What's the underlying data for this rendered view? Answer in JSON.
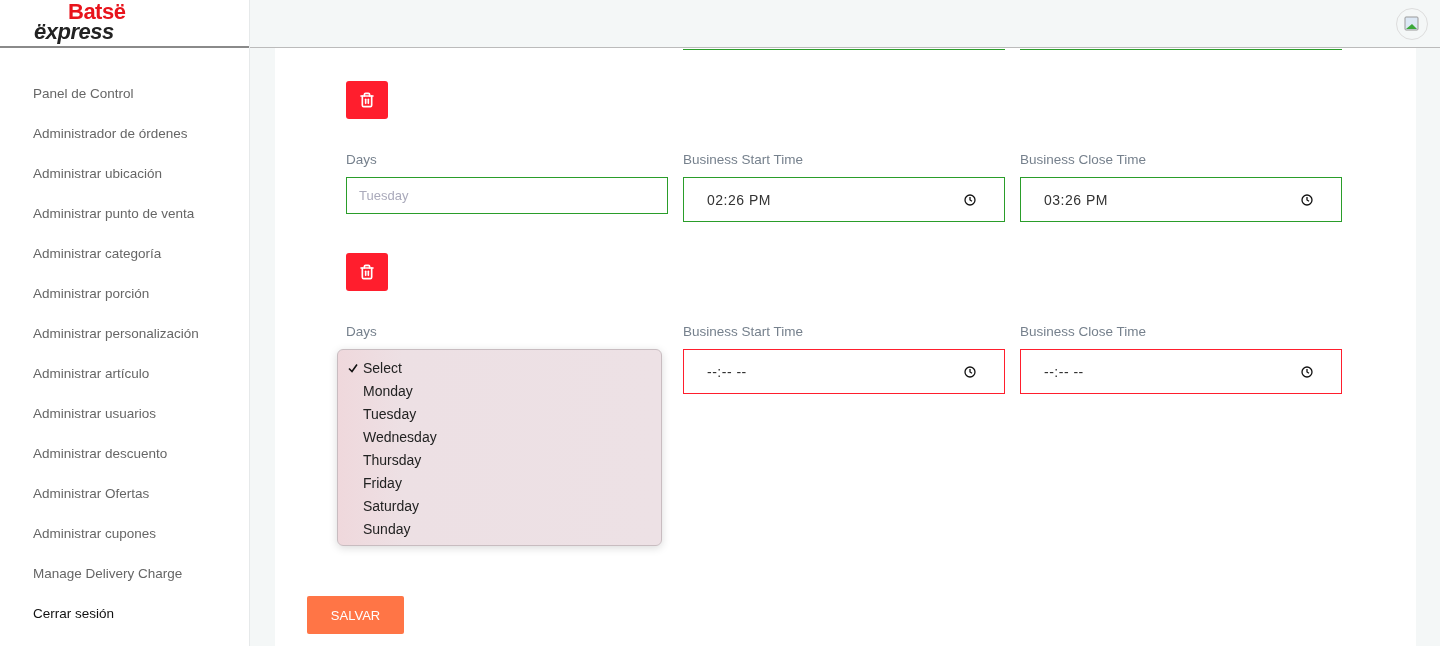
{
  "logo": {
    "top": "Batsë",
    "bottom": "ëxpress"
  },
  "sidebar": {
    "items": [
      {
        "label": "Panel de Control",
        "kind": "nav"
      },
      {
        "label": "Administrador de órdenes",
        "kind": "nav"
      },
      {
        "label": "Administrar ubicación",
        "kind": "nav"
      },
      {
        "label": "Administrar punto de venta",
        "kind": "nav"
      },
      {
        "label": "Administrar categoría",
        "kind": "nav"
      },
      {
        "label": "Administrar porción",
        "kind": "nav"
      },
      {
        "label": "Administrar personalización",
        "kind": "nav"
      },
      {
        "label": "Administrar artículo",
        "kind": "nav"
      },
      {
        "label": "Administrar usuarios",
        "kind": "nav"
      },
      {
        "label": "Administrar descuento",
        "kind": "nav"
      },
      {
        "label": "Administrar Ofertas",
        "kind": "nav"
      },
      {
        "label": "Administrar cupones",
        "kind": "nav"
      },
      {
        "label": "Manage Delivery Charge",
        "kind": "nav"
      },
      {
        "label": "Cerrar sesión",
        "kind": "logout"
      }
    ]
  },
  "schedule_rows": [
    {
      "days": {
        "label": "Days",
        "kind": "text",
        "placeholder": "Tuesday",
        "invalid": false
      },
      "start": {
        "label": "Business Start Time",
        "value": "02:26 PM",
        "invalid": false
      },
      "close": {
        "label": "Business Close Time",
        "value": "03:26 PM",
        "invalid": false
      }
    },
    {
      "days": {
        "label": "Days",
        "kind": "dropdown",
        "invalid": true,
        "options": [
          {
            "label": "Select",
            "selected": true
          },
          {
            "label": "Monday",
            "selected": false
          },
          {
            "label": "Tuesday",
            "selected": false
          },
          {
            "label": "Wednesday",
            "selected": false
          },
          {
            "label": "Thursday",
            "selected": false
          },
          {
            "label": "Friday",
            "selected": false
          },
          {
            "label": "Saturday",
            "selected": false
          },
          {
            "label": "Sunday",
            "selected": false
          }
        ]
      },
      "start": {
        "label": "Business Start Time",
        "value": "--:-- --",
        "invalid": true
      },
      "close": {
        "label": "Business Close Time",
        "value": "--:-- --",
        "invalid": true
      }
    }
  ],
  "save_button": "SALVAR"
}
